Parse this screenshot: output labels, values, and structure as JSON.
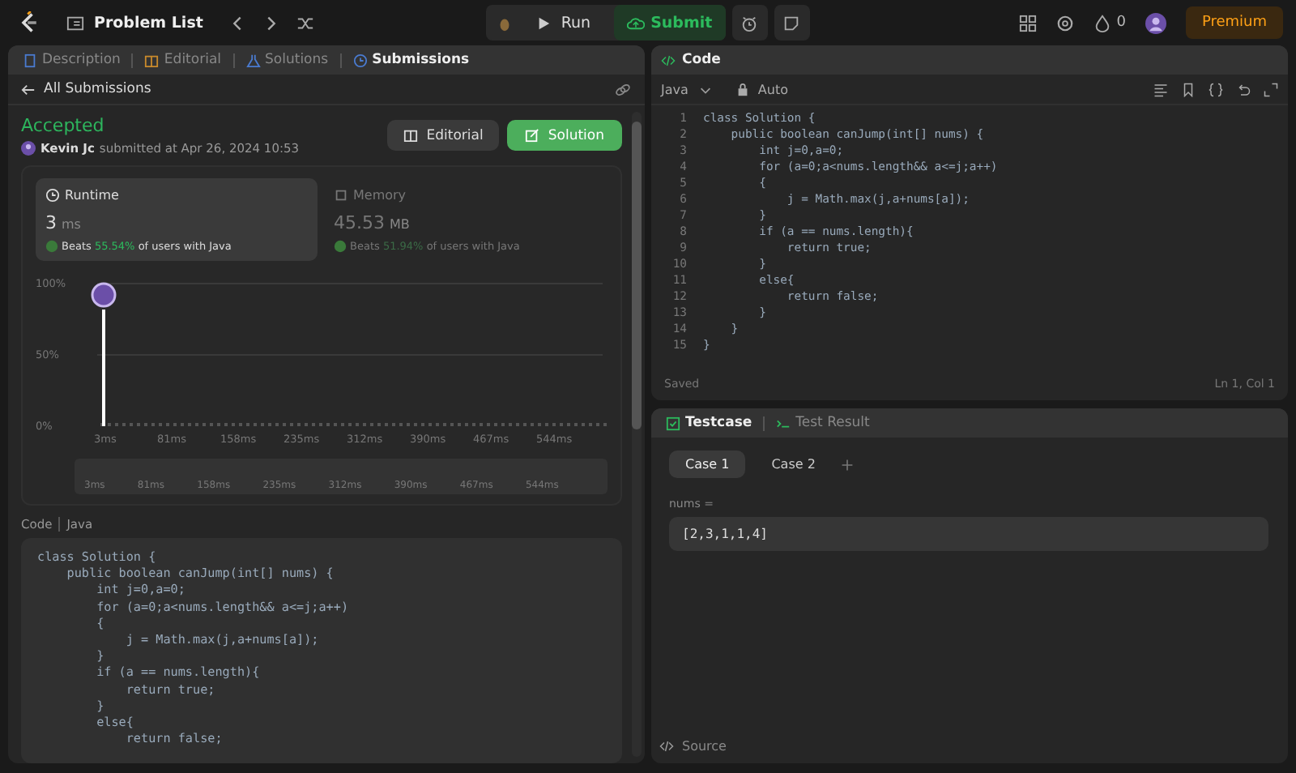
{
  "top_bar": {
    "nav_title": "Problem List",
    "run_label": "Run",
    "submit_label": "Submit",
    "streak_count": "0",
    "premium_label": "Premium"
  },
  "left_tabs": [
    {
      "label": "Description",
      "selected": false,
      "kind": "doc"
    },
    {
      "label": "Editorial",
      "selected": false,
      "kind": "book"
    },
    {
      "label": "Solutions",
      "selected": false,
      "kind": "flask"
    },
    {
      "label": "Submissions",
      "selected": true,
      "kind": "history"
    }
  ],
  "submission": {
    "back_label": "All Submissions",
    "status": "Accepted",
    "author": "Kevin Jc",
    "submitted_text": "submitted at Apr 26, 2024 10:53",
    "editorial_button": "Editorial",
    "solution_button": "Solution"
  },
  "stats": [
    {
      "kind": "runtime",
      "title": "Runtime",
      "value": "3",
      "unit": "ms",
      "beats_label": "Beats",
      "percent": "55.54%",
      "suffix": "of users with Java",
      "selected": true
    },
    {
      "kind": "memory",
      "title": "Memory",
      "value": "45.53",
      "unit": "MB",
      "beats_label": "Beats",
      "percent": "51.94%",
      "suffix": "of users with Java",
      "selected": false
    }
  ],
  "runtime_chart": {
    "y_labels": [
      "100%",
      "50%",
      "0%"
    ],
    "x_labels": [
      "3ms",
      "81ms",
      "158ms",
      "235ms",
      "312ms",
      "390ms",
      "467ms",
      "544ms"
    ],
    "navigator_labels": [
      "3ms",
      "81ms",
      "158ms",
      "235ms",
      "312ms",
      "390ms",
      "467ms",
      "544ms"
    ]
  },
  "code_view": {
    "title": "Code",
    "language": "Java",
    "lines": [
      "class Solution {",
      "    public boolean canJump(int[] nums) {",
      "        int j=0,a=0;",
      "        for (a=0;a<nums.length&& a<=j;a++)",
      "        {",
      "            j = Math.max(j,a+nums[a]);",
      "        }",
      "        if (a == nums.length){",
      "            return true;",
      "        }",
      "        else{",
      "            return false;"
    ]
  },
  "editor": {
    "title": "Code",
    "language": "Java",
    "mode": "Auto",
    "status": "Saved",
    "cursor": "Ln 1, Col 1",
    "lines": [
      {
        "num": "1",
        "text": "class Solution {"
      },
      {
        "num": "2",
        "text": "    public boolean canJump(int[] nums) {"
      },
      {
        "num": "3",
        "text": "        int j=0,a=0;"
      },
      {
        "num": "4",
        "text": "        for (a=0;a<nums.length&& a<=j;a++)"
      },
      {
        "num": "5",
        "text": "        {"
      },
      {
        "num": "6",
        "text": "            j = Math.max(j,a+nums[a]);"
      },
      {
        "num": "7",
        "text": "        }"
      },
      {
        "num": "8",
        "text": "        if (a == nums.length){"
      },
      {
        "num": "9",
        "text": "            return true;"
      },
      {
        "num": "10",
        "text": "        }"
      },
      {
        "num": "11",
        "text": "        else{"
      },
      {
        "num": "12",
        "text": "            return false;"
      },
      {
        "num": "13",
        "text": "        }"
      },
      {
        "num": "14",
        "text": "    }"
      },
      {
        "num": "15",
        "text": "}"
      }
    ]
  },
  "testcase": {
    "tabs": [
      {
        "label": "Testcase",
        "selected": true
      },
      {
        "label": "Test Result",
        "selected": false
      }
    ],
    "cases": [
      {
        "label": "Case 1",
        "selected": true
      },
      {
        "label": "Case 2",
        "selected": false
      }
    ],
    "param_label": "nums =",
    "param_value": "[2,3,1,1,4]",
    "source_label": "Source"
  }
}
